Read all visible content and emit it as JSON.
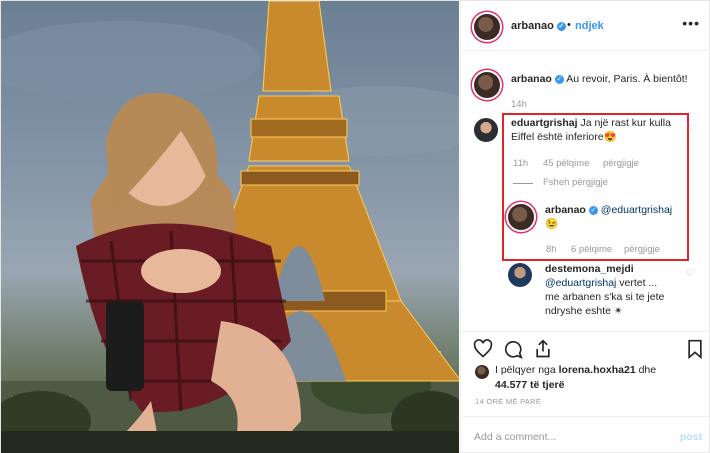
{
  "header": {
    "username": "arbanao",
    "separator": "•",
    "follow_label": "ndjek",
    "more_label": "•••"
  },
  "caption": {
    "username": "arbanao",
    "text": "Au revoir, Paris. À bientôt!",
    "time": "14h"
  },
  "comments": [
    {
      "username": "eduartgrishaj",
      "text": "Ja një rast kur kulla Eiffel është inferiore😍",
      "time": "11h",
      "likes": "45 pëlqime",
      "reply_label": "përgjigje",
      "hide_replies": "Fsheh përgjigje",
      "reply": {
        "username": "arbanao",
        "mention": "@eduartgrishaj",
        "text": "😉",
        "time": "8h",
        "likes": "6 pëlqime",
        "reply_label": "përgjigje"
      }
    },
    {
      "username": "destemona_mejdi",
      "mention": "@eduartgrishaj",
      "text_a": "vertet ...",
      "text_b": "me arbanen s'ka si te jete ndryshe eshte ✴"
    }
  ],
  "likes": {
    "prefix": "I pëlqyer nga",
    "user": "lorena.hoxha21",
    "and": "dhe",
    "count": "44.577",
    "suffix": "të tjerë"
  },
  "timestamp": "14 ORË MË PARË",
  "add_comment": {
    "placeholder": "Add a comment...",
    "post_label": "post"
  },
  "icons": [
    "heart-icon",
    "comment-icon",
    "share-icon",
    "bookmark-icon",
    "verified-icon",
    "more-icon"
  ],
  "colors": {
    "accent": "#3897f0",
    "highlight": "#e0242b",
    "muted": "#999999"
  }
}
